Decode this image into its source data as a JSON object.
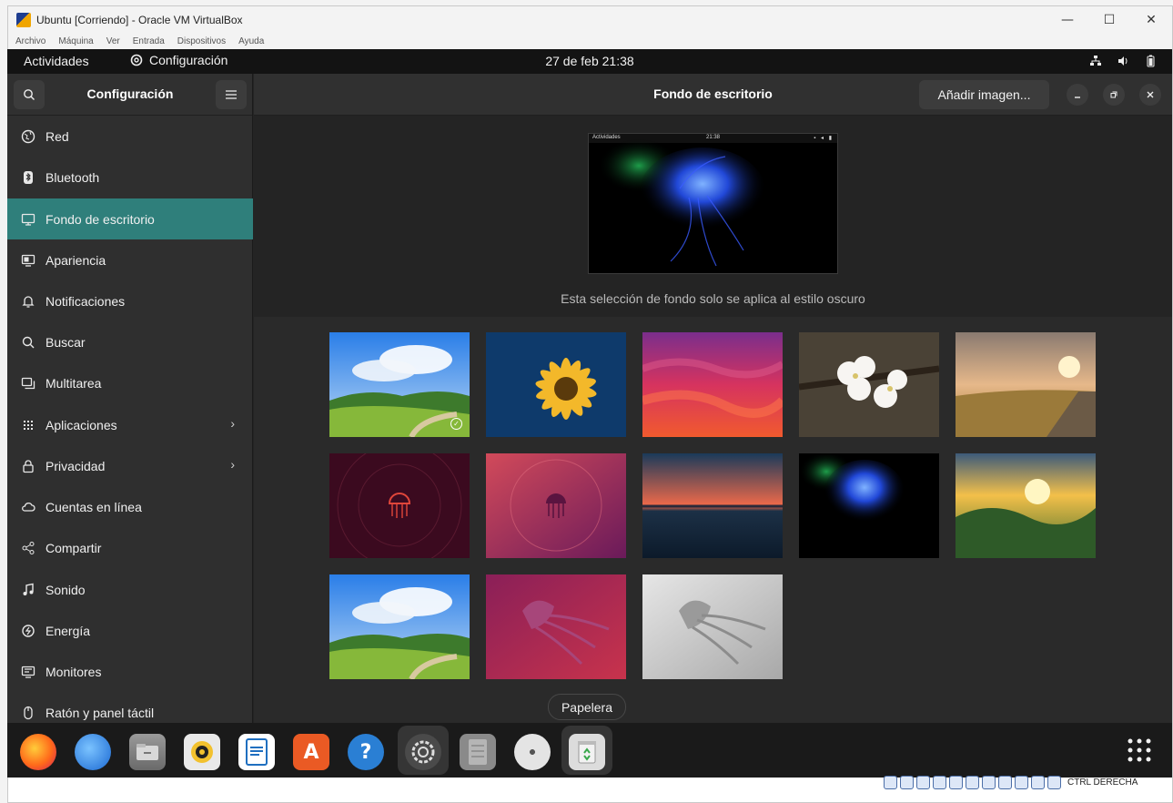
{
  "host_window": {
    "title": "Ubuntu [Corriendo] - Oracle VM VirtualBox",
    "menus": [
      "Archivo",
      "Máquina",
      "Ver",
      "Entrada",
      "Dispositivos",
      "Ayuda"
    ],
    "status_host_key": "CTRL DERECHA"
  },
  "topbar": {
    "activities": "Actividades",
    "app_name": "Configuración",
    "clock": "27 de feb  21:38"
  },
  "sidebar": {
    "title": "Configuración",
    "items": [
      {
        "label": "Red",
        "icon": "globe-icon"
      },
      {
        "label": "Bluetooth",
        "icon": "bluetooth-icon"
      },
      {
        "label": "Fondo de escritorio",
        "icon": "monitor-icon"
      },
      {
        "label": "Apariencia",
        "icon": "appearance-icon"
      },
      {
        "label": "Notificaciones",
        "icon": "bell-icon"
      },
      {
        "label": "Buscar",
        "icon": "search-icon"
      },
      {
        "label": "Multitarea",
        "icon": "multitask-icon"
      },
      {
        "label": "Aplicaciones",
        "icon": "grid-icon"
      },
      {
        "label": "Privacidad",
        "icon": "lock-icon"
      },
      {
        "label": "Cuentas en línea",
        "icon": "cloud-icon"
      },
      {
        "label": "Compartir",
        "icon": "share-icon"
      },
      {
        "label": "Sonido",
        "icon": "music-note-icon"
      },
      {
        "label": "Energía",
        "icon": "power-icon"
      },
      {
        "label": "Monitores",
        "icon": "display-icon"
      },
      {
        "label": "Ratón y panel táctil",
        "icon": "mouse-icon"
      }
    ]
  },
  "content": {
    "title": "Fondo de escritorio",
    "add_image": "Añadir imagen...",
    "preview_note": "Esta selección de fondo solo se aplica al estilo oscuro",
    "preview_topbar": {
      "activities": "Actividades",
      "clock": "21:38"
    }
  },
  "dock": {
    "tooltip": "Papelera"
  },
  "colors": {
    "accent": "#2f7f7b",
    "sidebar_bg": "#2f2f2f",
    "content_bg": "#242424"
  }
}
